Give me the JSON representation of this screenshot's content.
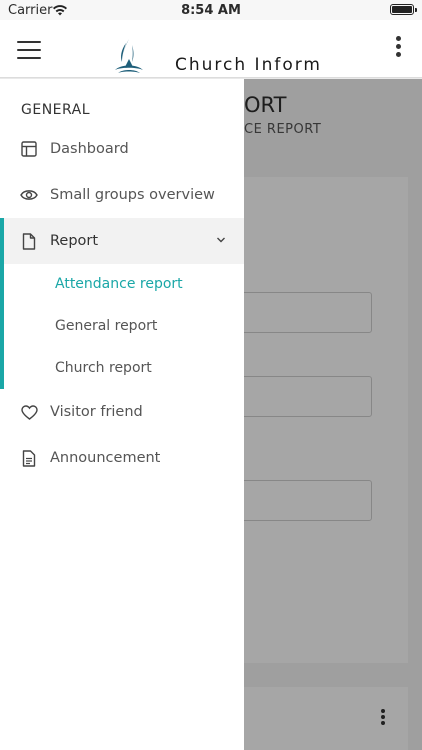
{
  "status_bar": {
    "carrier": "Carrier",
    "time": "8:54 AM"
  },
  "header": {
    "title": "Church Inform",
    "logo_icon": "church-logo-icon",
    "menu_icon": "hamburger-menu-icon",
    "more_icon": "more-vert-icon"
  },
  "page": {
    "title": "ORT",
    "subtitle": "CE REPORT"
  },
  "drawer": {
    "section": "GENERAL",
    "items": [
      {
        "label": "Dashboard",
        "icon": "dashboard-icon"
      },
      {
        "label": "Small groups overview",
        "icon": "eye-icon"
      },
      {
        "label": "Report",
        "icon": "file-icon",
        "expanded": true
      },
      {
        "label": "Visitor friend",
        "icon": "heart-icon"
      },
      {
        "label": "Announcement",
        "icon": "document-icon"
      }
    ],
    "report_subitems": [
      {
        "label": "Attendance report",
        "selected": true
      },
      {
        "label": "General report"
      },
      {
        "label": "Church report"
      }
    ]
  },
  "colors": {
    "accent": "#1aa7a7",
    "logo": "#1f5f7a"
  }
}
